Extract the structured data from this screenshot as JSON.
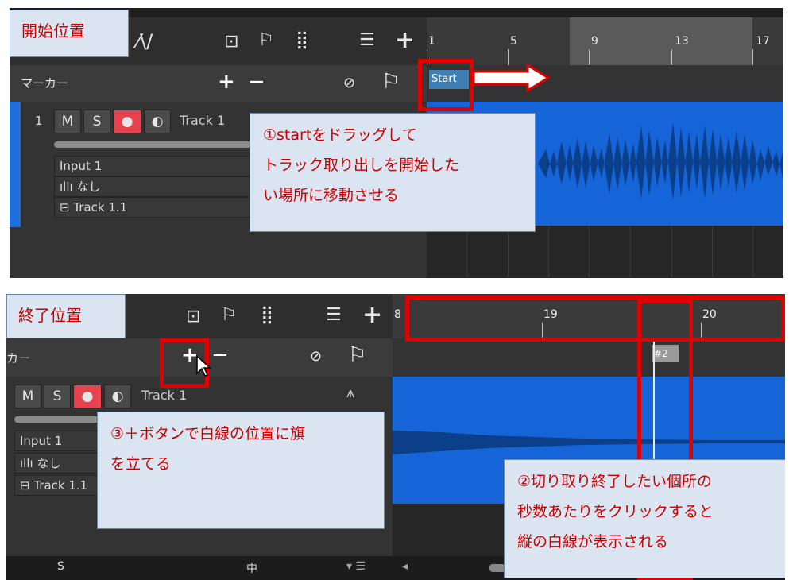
{
  "top_panel": {
    "callout_label": "開始位置",
    "ruler_numbers": [
      "1",
      "5",
      "9",
      "13",
      "17"
    ],
    "markers_label": "マーカー",
    "add_marker": "+",
    "remove_marker": "−",
    "start_marker": "Start",
    "track": {
      "number": "1",
      "m": "M",
      "s": "S",
      "name": "Track 1",
      "input": "Input 1",
      "insert": "なし",
      "output": "Track 1.1"
    },
    "note": [
      "①startをドラッグして",
      "トラック取り出しを開始した",
      "い場所に移動させる"
    ]
  },
  "bottom_panel": {
    "callout_label": "終了位置",
    "ruler_numbers": [
      "8",
      "19",
      "20"
    ],
    "markers_label": "カー",
    "add_marker": "+",
    "remove_marker": "−",
    "marker_flag": "#2",
    "track": {
      "m": "M",
      "s": "S",
      "name": "Track 1",
      "input": "Input 1",
      "insert": "なし",
      "output": "Track 1.1"
    },
    "note_plus": [
      "③＋ボタンで白線の位置に旗",
      "を立てる"
    ],
    "note_click": [
      "②切り取り終了したい個所の",
      "秒数あたりをクリックすると",
      "縦の白線が表示される"
    ],
    "footer": {
      "left": "S",
      "mid": "中"
    }
  },
  "colors": {
    "accent_red": "#e00000",
    "waveform_blue": "#1565d8",
    "record_red": "#e8424f"
  }
}
